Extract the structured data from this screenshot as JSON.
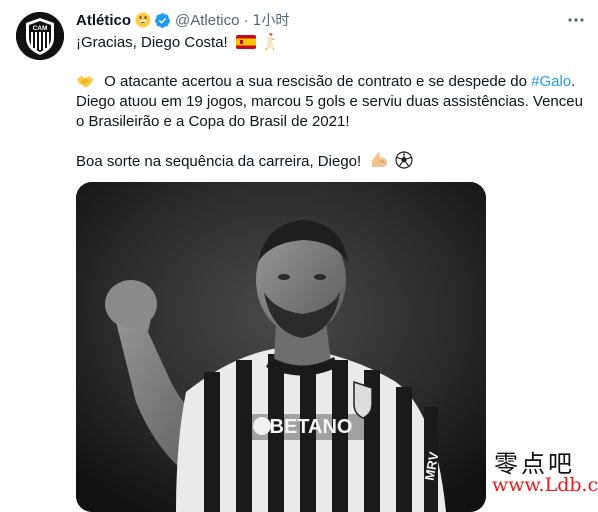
{
  "tweet": {
    "author_name": "Atlético",
    "handle": "@Atletico",
    "separator": "·",
    "time": "1小时",
    "lines": [
      "¡Gracias, Diego Costa!",
      "O atacante acertou a sua rescisão de contrato e se despede do",
      "Diego atuou em 19 jogos, marcou 5 gols e serviu duas assistências. Venceu",
      "o Brasileirão e a Copa do Brasil de 2021!",
      "Boa sorte na sequência da carreira, Diego!"
    ],
    "hashtag": "#Galo",
    "line2_suffix": "."
  },
  "avatar_logo_text": "CAM",
  "media": {
    "jersey_sponsor": "BETANO",
    "jersey_brand": "MRV"
  },
  "watermark": {
    "chinese": "零点吧",
    "url": "www.Ldb.cc"
  },
  "colors": {
    "link": "#1d9bf0",
    "verified": "#1d9bf0",
    "secondary_text": "#536471"
  },
  "icons": {
    "more": "more-horizontal-icon",
    "verified": "verified-badge-icon",
    "flag": "spain-flag-icon",
    "rooster": "rooster-icon",
    "handshake": "handshake-icon",
    "muscle": "flexed-biceps-icon",
    "ball": "soccer-ball-icon"
  }
}
